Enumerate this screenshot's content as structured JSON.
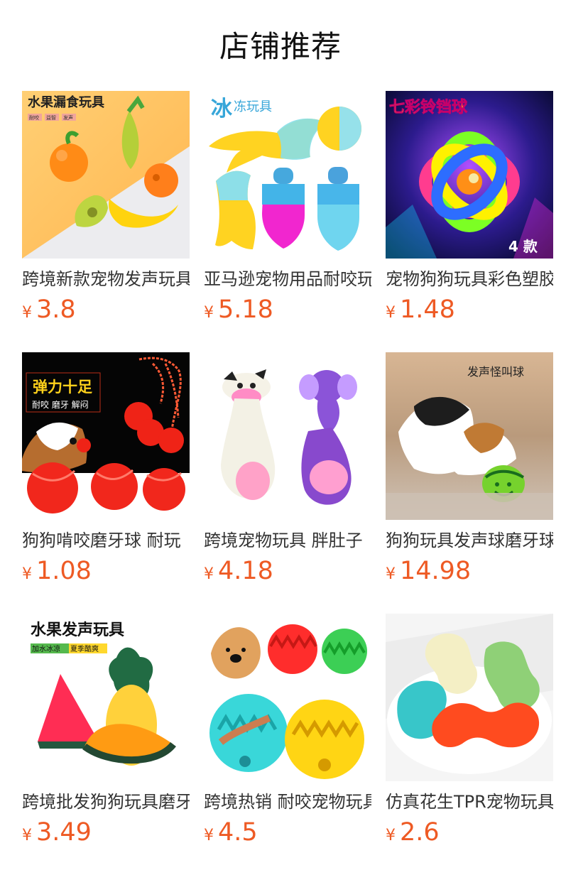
{
  "section": {
    "title": "店铺推荐"
  },
  "colors": {
    "price": "#ee5a24",
    "text": "#333333",
    "background": "#ffffff"
  },
  "products": [
    {
      "name": "跨境新款宠物发声玩具",
      "currency": "¥",
      "price": "3.8",
      "image_text": {
        "title": "水果漏食玩具",
        "tags": [
          "耐咬",
          "益智",
          "发声"
        ]
      }
    },
    {
      "name": "亚马逊宠物用品耐咬玩具",
      "currency": "¥",
      "price": "5.18",
      "image_text": {
        "title_a": "冰",
        "title_b": "冻玩具"
      }
    },
    {
      "name": "宠物狗狗玩具彩色塑胶球",
      "currency": "¥",
      "price": "1.48",
      "image_text": {
        "title": "七彩铃铛球",
        "badge": "4 款"
      }
    },
    {
      "name": "狗狗啃咬磨牙球 耐玩",
      "currency": "¥",
      "price": "1.08",
      "image_text": {
        "title": "弹力十足",
        "subtitle": "耐咬 磨牙 解闷"
      }
    },
    {
      "name": "跨境宠物玩具 胖肚子",
      "currency": "¥",
      "price": "4.18",
      "image_text": {}
    },
    {
      "name": "狗狗玩具发声球磨牙球",
      "currency": "¥",
      "price": "14.98",
      "image_text": {
        "title": "发声怪叫球"
      }
    },
    {
      "name": "跨境批发狗狗玩具磨牙",
      "currency": "¥",
      "price": "3.49",
      "image_text": {
        "title": "水果发声玩具",
        "tag_a": "加水冰凉",
        "tag_b": "夏季酷爽"
      }
    },
    {
      "name": "跨境热销 耐咬宠物玩具",
      "currency": "¥",
      "price": "4.5",
      "image_text": {}
    },
    {
      "name": "仿真花生TPR宠物玩具",
      "currency": "¥",
      "price": "2.6",
      "image_text": {}
    }
  ]
}
